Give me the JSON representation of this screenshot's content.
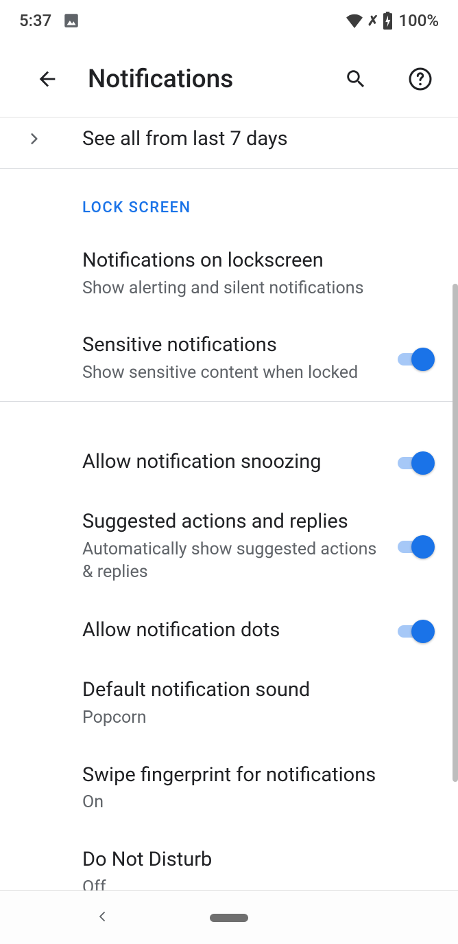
{
  "status_bar": {
    "time": "5:37",
    "battery": "100%"
  },
  "app_bar": {
    "title": "Notifications"
  },
  "see_all": {
    "label": "See all from last 7 days"
  },
  "section_lock_screen": {
    "header": "LOCK SCREEN",
    "notifications_on_lockscreen": {
      "title": "Notifications on lockscreen",
      "subtitle": "Show alerting and silent notifications"
    },
    "sensitive_notifications": {
      "title": "Sensitive notifications",
      "subtitle": "Show sensitive content when locked",
      "enabled": true
    }
  },
  "section_general": {
    "allow_snoozing": {
      "title": "Allow notification snoozing",
      "enabled": true
    },
    "suggested_actions": {
      "title": "Suggested actions and replies",
      "subtitle": "Automatically show suggested actions & replies",
      "enabled": true
    },
    "allow_dots": {
      "title": "Allow notification dots",
      "enabled": true
    },
    "default_sound": {
      "title": "Default notification sound",
      "subtitle": "Popcorn"
    },
    "swipe_fingerprint": {
      "title": "Swipe fingerprint for notifications",
      "subtitle": "On"
    },
    "dnd": {
      "title": "Do Not Disturb",
      "subtitle": "Off"
    }
  }
}
